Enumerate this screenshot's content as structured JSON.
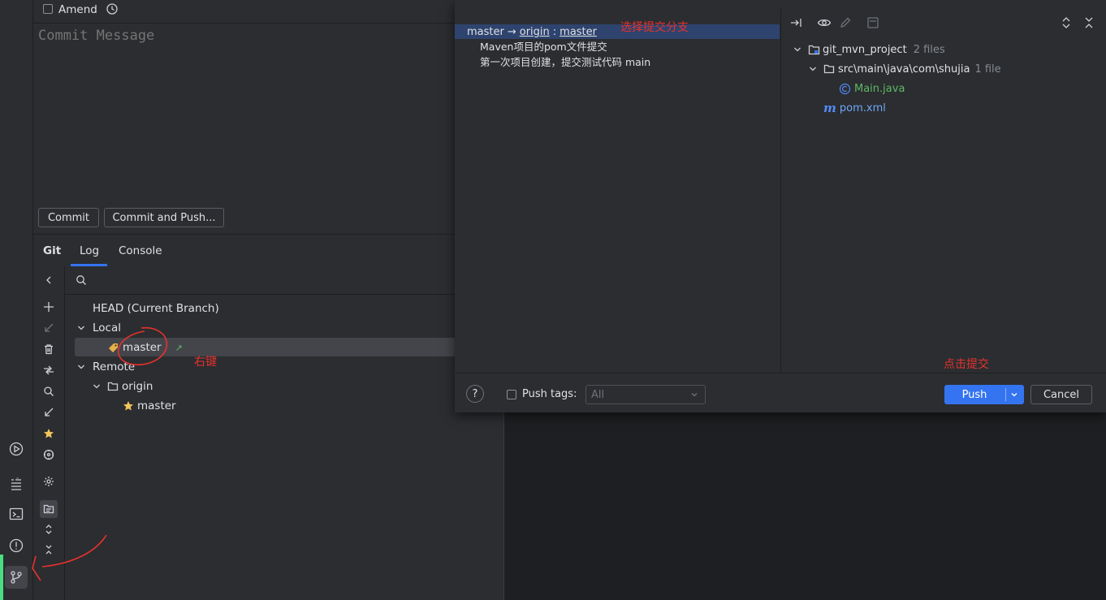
{
  "commit_panel": {
    "amend_label": "Amend",
    "message_placeholder": "Commit Message",
    "commit_button": "Commit",
    "commit_and_push_button": "Commit and Push..."
  },
  "tabs": [
    {
      "label": "Git"
    },
    {
      "label": "Log",
      "active": true
    },
    {
      "label": "Console"
    }
  ],
  "branches": {
    "head_label": "HEAD (Current Branch)",
    "local_label": "Local",
    "local_branch": "master",
    "remote_label": "Remote",
    "remote_name": "origin",
    "remote_branch": "master"
  },
  "push_dialog": {
    "branch_source": "master",
    "arrow": "→",
    "remote": "origin",
    "separator": ":",
    "target": "master",
    "commits": [
      "Maven项目的pom文件提交",
      "第一次项目创建，提交测试代码 main"
    ],
    "tree": {
      "project": "git_mvn_project",
      "project_count": "2 files",
      "package_path": "src\\main\\java\\com\\shujia",
      "package_count": "1 file",
      "file1": "Main.java",
      "file2": "pom.xml"
    },
    "push_tags_label": "Push tags:",
    "push_tags_value": "All",
    "push_button": "Push",
    "cancel_button": "Cancel",
    "help_label": "?"
  },
  "annotations": {
    "select_branch": "选择提交分支",
    "right_click": "右键",
    "click_push": "点击提交"
  },
  "colors": {
    "accent": "#3574f0",
    "annotation": "#e5322d",
    "git_active": "#4ade80"
  }
}
